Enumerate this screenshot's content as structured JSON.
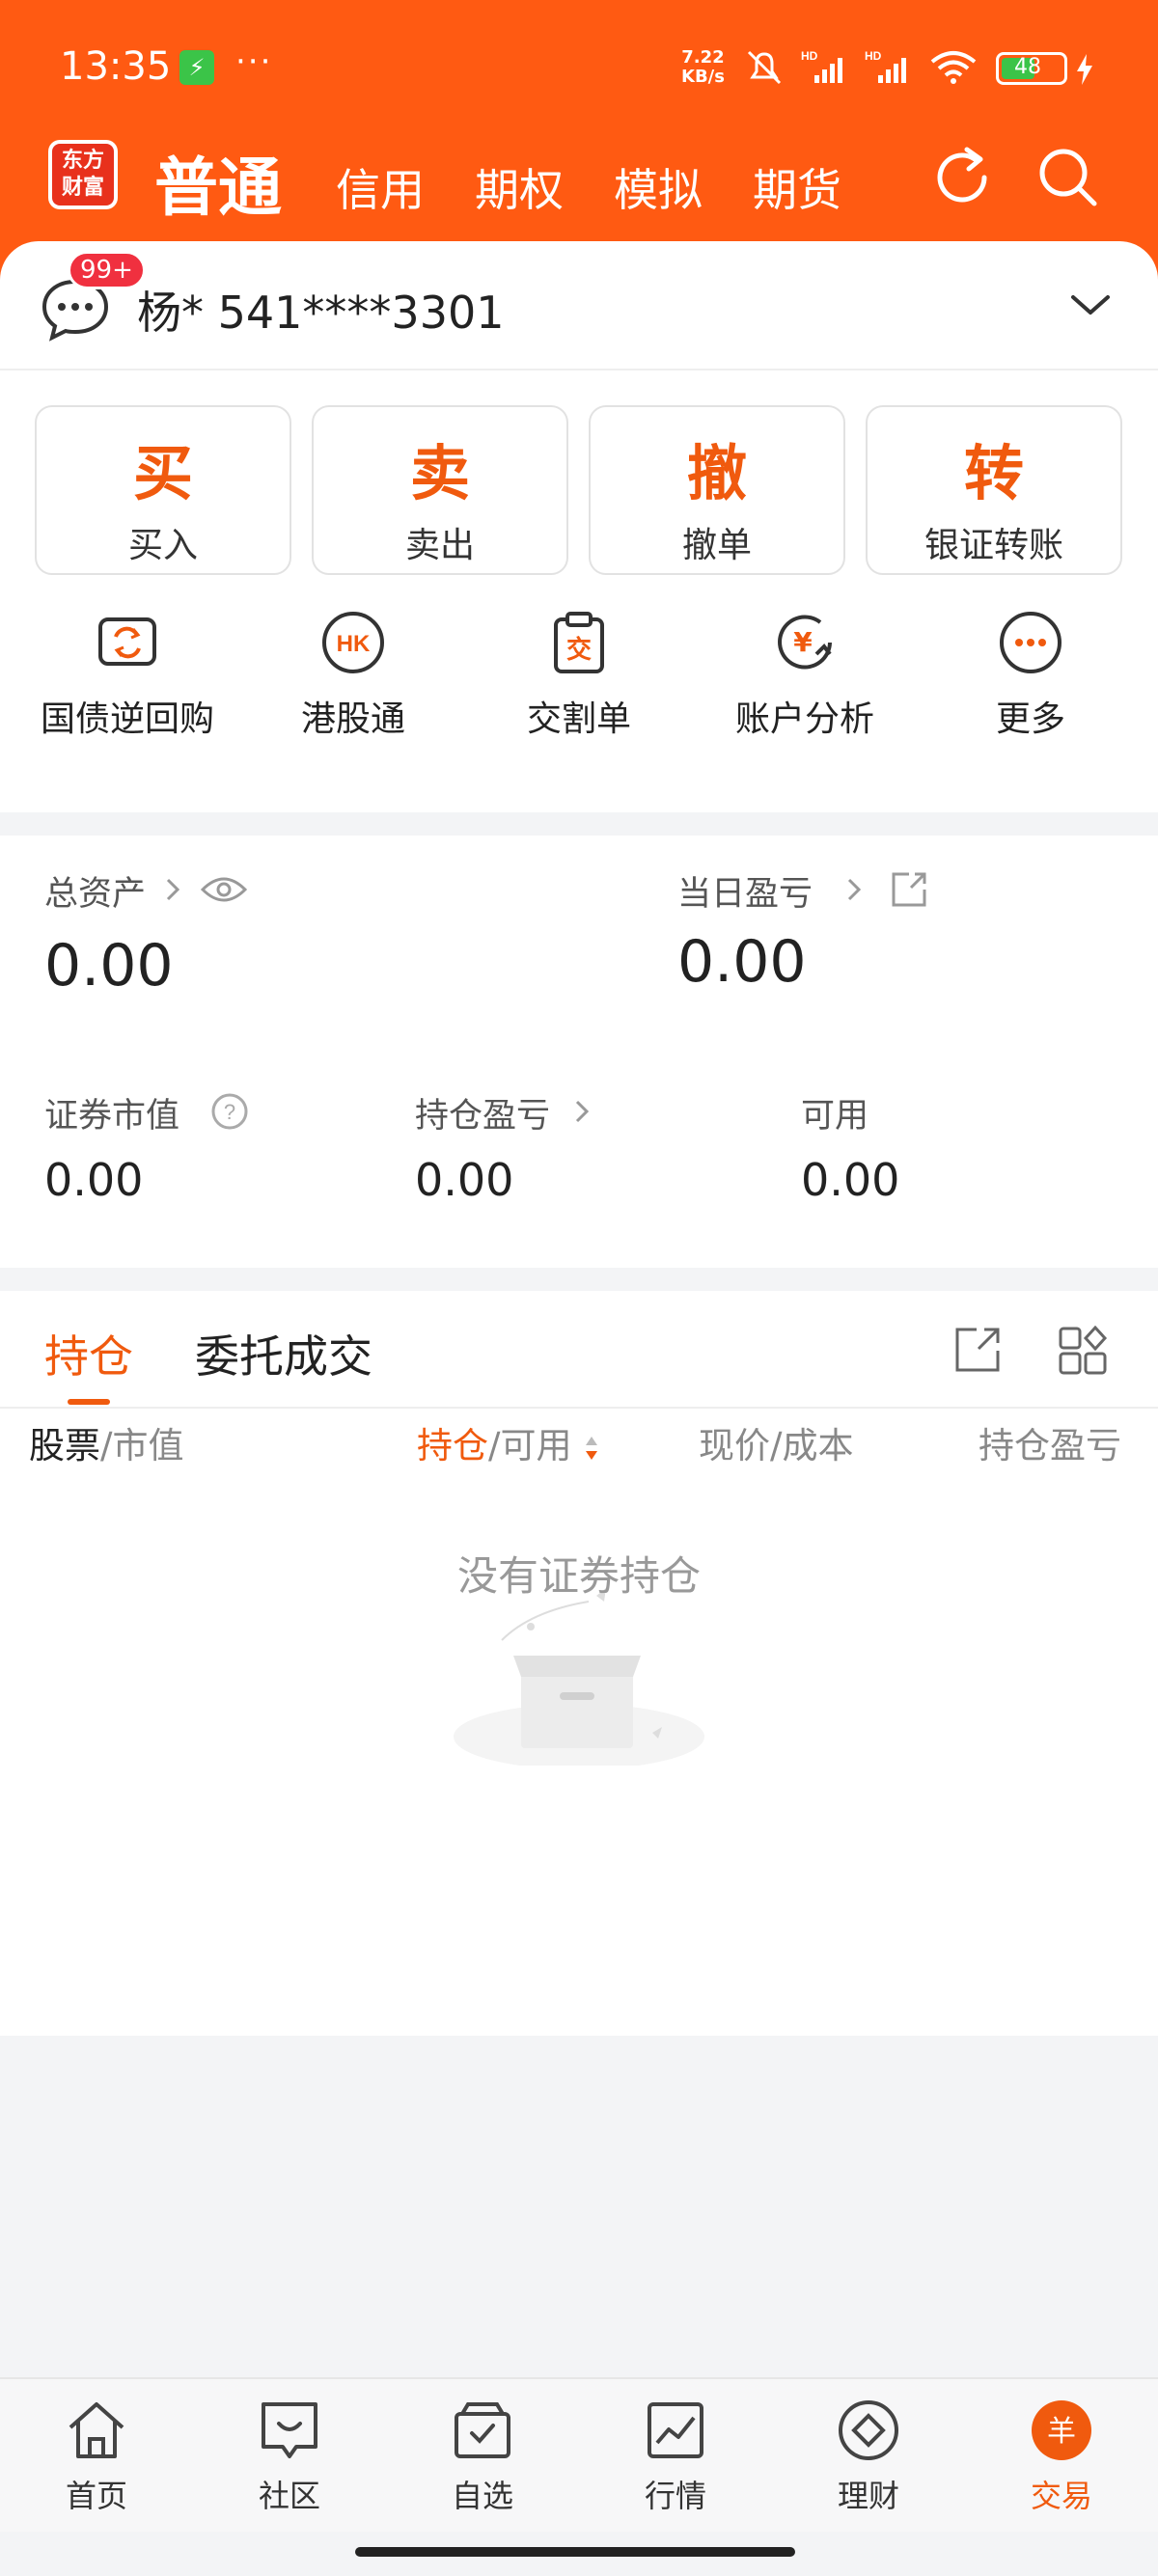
{
  "status_bar": {
    "time": "13:35",
    "dots": "···",
    "net_speed_value": "7.22",
    "net_speed_unit": "KB/s",
    "battery": "48"
  },
  "top_nav": {
    "logo_text_1": "东方",
    "logo_text_2": "财富",
    "tabs": [
      "普通",
      "信用",
      "期权",
      "模拟",
      "期货"
    ],
    "active_tab": "普通"
  },
  "account": {
    "badge": "99+",
    "label": "杨* 541****3301"
  },
  "big_actions": [
    {
      "glyph": "买",
      "label": "买入"
    },
    {
      "glyph": "卖",
      "label": "卖出"
    },
    {
      "glyph": "撤",
      "label": "撤单"
    },
    {
      "glyph": "转",
      "label": "银证转账"
    }
  ],
  "quick_links": [
    {
      "label": "国债逆回购",
      "icon": "repo-icon"
    },
    {
      "label": "港股通",
      "icon": "hk-icon",
      "icon_text": "HK"
    },
    {
      "label": "交割单",
      "icon": "clipboard-icon",
      "icon_text": "交"
    },
    {
      "label": "账户分析",
      "icon": "analysis-icon",
      "icon_text": "¥"
    },
    {
      "label": "更多",
      "icon": "more-icon"
    }
  ],
  "assets": {
    "total_label": "总资产",
    "total_value": "0.00",
    "daily_pnl_label": "当日盈亏",
    "daily_pnl_value": "0.00",
    "market_value_label": "证券市值",
    "market_value": "0.00",
    "position_pnl_label": "持仓盈亏",
    "position_pnl_value": "0.00",
    "available_label": "可用",
    "available_value": "0.00"
  },
  "position_tabs": {
    "active": "持仓",
    "other": "委托成交"
  },
  "columns": {
    "stock_a": "股票",
    "stock_b": "/市值",
    "hold_a": "持仓",
    "hold_b": "/可用",
    "price": "现价/成本",
    "pnl": "持仓盈亏"
  },
  "empty_message": "没有证券持仓",
  "bottom_nav": [
    {
      "label": "首页",
      "icon": "home-icon"
    },
    {
      "label": "社区",
      "icon": "community-icon"
    },
    {
      "label": "自选",
      "icon": "watchlist-icon"
    },
    {
      "label": "行情",
      "icon": "market-icon"
    },
    {
      "label": "理财",
      "icon": "wealth-icon"
    },
    {
      "label": "交易",
      "icon": "trade-icon",
      "icon_text": "羊"
    }
  ],
  "colors": {
    "brand": "#ff5a12",
    "accent": "#f05a0e",
    "badge": "#f0303f"
  }
}
